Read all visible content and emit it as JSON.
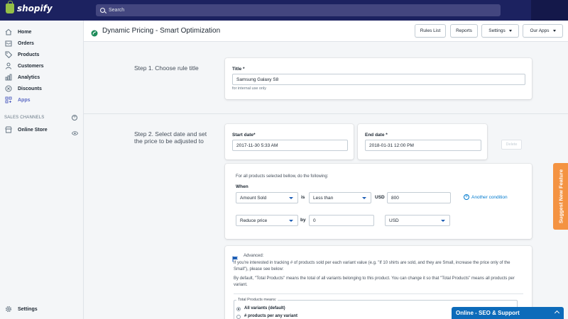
{
  "topbar": {
    "brand": "shopify",
    "search_placeholder": "Search"
  },
  "sidebar": {
    "items": [
      {
        "label": "Home",
        "icon": "home-icon"
      },
      {
        "label": "Orders",
        "icon": "orders-icon"
      },
      {
        "label": "Products",
        "icon": "tag-icon"
      },
      {
        "label": "Customers",
        "icon": "person-icon"
      },
      {
        "label": "Analytics",
        "icon": "bar-chart-icon"
      },
      {
        "label": "Discounts",
        "icon": "discount-icon"
      },
      {
        "label": "Apps",
        "icon": "apps-icon"
      }
    ],
    "sales_channels_heading": "SALES CHANNELS",
    "online_store": "Online Store",
    "settings": "Settings"
  },
  "header": {
    "title": "Dynamic Pricing - Smart Optimization",
    "buttons": {
      "rules_list": "Rules List",
      "reports": "Reports",
      "settings": "Settings",
      "our_apps": "Our Apps"
    }
  },
  "step1": {
    "label": "Step 1. Choose rule title",
    "title_label": "Title *",
    "title_value": "Samsung Galaxy S8",
    "help": "for internal use only"
  },
  "step2": {
    "label": "Step 2. Select date and set the price to be adjusted to",
    "start_label": "Start date*",
    "start_value": "2017-11-30 5:33 AM",
    "end_label": "End date *",
    "end_value": "2018-01-31 12:00 PM",
    "delete": "Delete"
  },
  "conditions": {
    "intro": "For all products selected bellow, do the following:",
    "when": "When",
    "field": "Amount Sold",
    "is": "is",
    "operator": "Less than",
    "currency_label": "USD",
    "amount": "800",
    "another": "Another condition",
    "action": "Reduce price",
    "by": "by",
    "by_value": "0",
    "unit": "USD"
  },
  "advanced": {
    "title": "Advanced:",
    "text1": "If you're interested in tracking # of products sold per each variant value (e.g. \"If 10 shirts are sold, and they are Small, increase the price only of the Small\"), please see below:",
    "text2": "By default, \"Total Products\" means the total of all variants belonging to this product. You can change it so that \"Total Products\" means all products per variant.",
    "fieldset": "Total Products means:",
    "option1": "All variants (default)",
    "option2": "# products per any variant"
  },
  "widgets": {
    "suggest": "Suggest New Feature",
    "chat": "Online - SEO & Support"
  },
  "colors": {
    "topbar": "#1c2260",
    "accent": "#5c6ac4",
    "link": "#007ace",
    "suggest": "#f49342",
    "chat": "#0d6bba"
  }
}
